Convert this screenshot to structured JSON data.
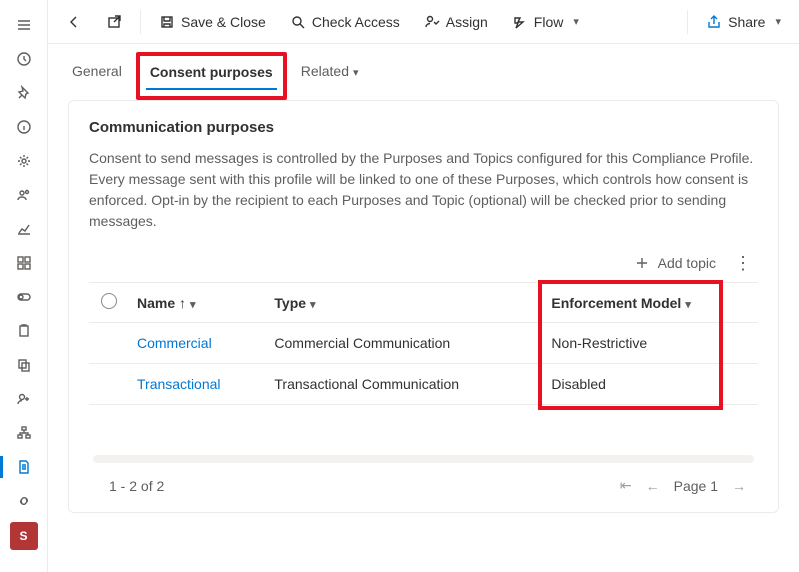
{
  "commands": {
    "save_close": "Save & Close",
    "check_access": "Check Access",
    "assign": "Assign",
    "flow": "Flow",
    "share": "Share"
  },
  "tabs": {
    "general": "General",
    "consent": "Consent purposes",
    "related": "Related"
  },
  "panel": {
    "title": "Communication purposes",
    "description": "Consent to send messages is controlled by the Purposes and Topics configured for this Compliance Profile. Every message sent with this profile will be linked to one of these Purposes, which controls how consent is enforced. Opt-in by the recipient to each Purposes and Topic (optional) will be checked prior to sending messages."
  },
  "toolbar": {
    "add_topic": "Add topic"
  },
  "columns": {
    "name": "Name",
    "type": "Type",
    "enforcement": "Enforcement Model"
  },
  "rows": [
    {
      "name": "Commercial",
      "type": "Commercial Communication",
      "enforcement": "Non-Restrictive"
    },
    {
      "name": "Transactional",
      "type": "Transactional Communication",
      "enforcement": "Disabled"
    }
  ],
  "paging": {
    "range": "1 - 2 of 2",
    "page_label": "Page 1"
  },
  "rail_accent": "S"
}
